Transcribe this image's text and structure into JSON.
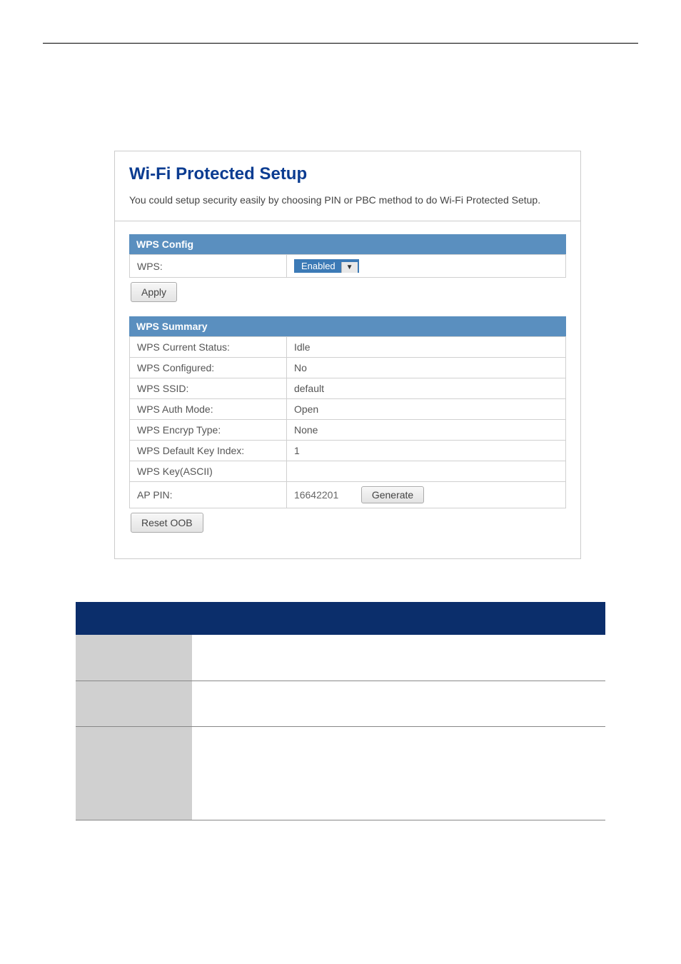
{
  "panel": {
    "title": "Wi-Fi Protected Setup",
    "description": "You could setup security easily by choosing PIN or PBC method to do Wi-Fi Protected Setup."
  },
  "wps_config": {
    "header": "WPS Config",
    "wps_label": "WPS:",
    "wps_value": "Enabled",
    "apply_label": "Apply"
  },
  "wps_summary": {
    "header": "WPS Summary",
    "rows": {
      "current_status_label": "WPS Current Status:",
      "current_status_value": "Idle",
      "configured_label": "WPS Configured:",
      "configured_value": "No",
      "ssid_label": "WPS SSID:",
      "ssid_value": "default",
      "auth_mode_label": "WPS Auth Mode:",
      "auth_mode_value": "Open",
      "encryp_type_label": "WPS Encryp Type:",
      "encryp_type_value": "None",
      "default_key_index_label": "WPS Default Key Index:",
      "default_key_index_value": "1",
      "key_ascii_label": "WPS Key(ASCII)",
      "key_ascii_value": "",
      "ap_pin_label": "AP PIN:",
      "ap_pin_value": "16642201",
      "generate_label": "Generate"
    },
    "reset_label": "Reset OOB"
  }
}
